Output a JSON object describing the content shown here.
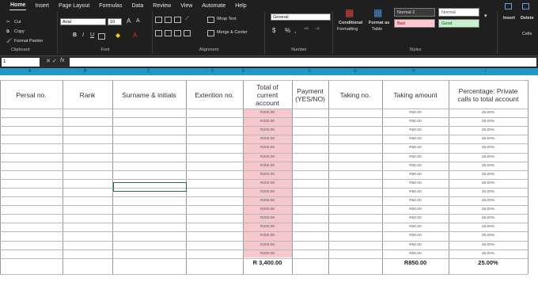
{
  "ribbon": {
    "tabs": [
      "Home",
      "Insert",
      "Page Layout",
      "Formulas",
      "Data",
      "Review",
      "View",
      "Automate",
      "Help"
    ],
    "clipboard": {
      "cut": "Cut",
      "copy": "Copy",
      "format_painter": "Format Painter",
      "label": "Clipboard"
    },
    "font": {
      "name": "Arial",
      "size": "10",
      "grow": "A",
      "shrink": "A",
      "bold": "B",
      "italic": "I",
      "underline": "U",
      "label": "Font"
    },
    "alignment": {
      "wrap_text": "Wrap Text",
      "merge_center": "Merge & Center",
      "label": "Alignment"
    },
    "number": {
      "format": "General",
      "currency": "$",
      "percent": "%",
      "comma": ",",
      "label": "Number"
    },
    "styles": {
      "conditional": "Conditional",
      "conditional2": "Formatting",
      "format_as": "Format as",
      "format_as2": "Table",
      "normal2": "Normal 2",
      "normal": "Normal",
      "bad": "Bad",
      "good": "Good",
      "label": "Styles"
    },
    "cells": {
      "insert": "Insert",
      "delete": "Delete",
      "label": "Cells"
    }
  },
  "formula_bar": {
    "name_box": "1",
    "fx": "fx"
  },
  "columns": [
    "A",
    "B",
    "C",
    "D",
    "E",
    "F",
    "G",
    "H",
    "I"
  ],
  "table": {
    "headers": {
      "persal": "Persal no.",
      "rank": "Rank",
      "surname": "Surname & initials",
      "extension": "Extention no.",
      "total1": "Total of",
      "total2": "current",
      "total3": "account",
      "payment1": "Payment",
      "payment2": "(YES/NO)",
      "taking_no": "Taking no.",
      "taking_amount": "Taking amount",
      "pct1": "Percentage: Private",
      "pct2": "calls to total account"
    },
    "total_account_values": [
      "R200.00",
      "R200.00",
      "R200.00",
      "R200.00",
      "R200.00",
      "R200.00",
      "R200.00",
      "R200.00",
      "R200.00",
      "R200.00",
      "R200.00",
      "R200.00",
      "R200.00",
      "R200.00",
      "R200.00",
      "R200.00",
      "R200.00"
    ],
    "taking_amount_values": [
      "R50.00",
      "R50.00",
      "R50.00",
      "R50.00",
      "R50.00",
      "R50.00",
      "R50.00",
      "R50.00",
      "R50.00",
      "R50.00",
      "R50.00",
      "R50.00",
      "R50.00",
      "R50.00",
      "R50.00",
      "R50.00",
      "R50.00"
    ],
    "percentage_values": [
      "25.00%",
      "25.00%",
      "25.00%",
      "25.00%",
      "25.00%",
      "25.00%",
      "25.00%",
      "25.00%",
      "25.00%",
      "25.00%",
      "25.00%",
      "25.00%",
      "25.00%",
      "25.00%",
      "25.00%",
      "25.00%",
      "25.00%"
    ],
    "totals": {
      "total_account": "R 3,400.00",
      "taking_amount": "R850.00",
      "percentage": "25.00%"
    }
  },
  "colors": {
    "pink_fill": "#f6c8cc",
    "column_header": "#2596c8",
    "ribbon_bg": "#1f1f1f"
  }
}
